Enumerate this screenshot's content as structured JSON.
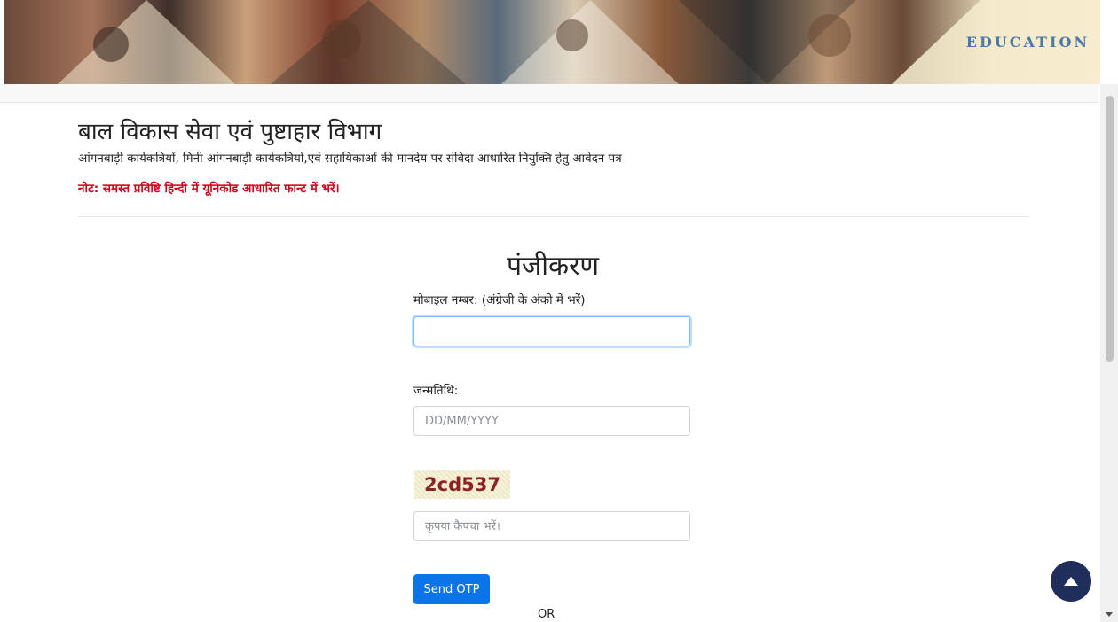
{
  "banner": {
    "word": "EDUCATION"
  },
  "header": {
    "title": "बाल विकास सेवा एवं पुष्टाहार विभाग",
    "subtitle": "आंगनबाड़ी कार्यकत्रियों, मिनी आंगनबाड़ी कार्यकत्रियों,एवं सहायिकाओं की मानदेय पर संविदा आधारित नियुक्ति हेतु आवेदन पत्र",
    "note": "नोट: समस्त प्रविष्टि हिन्दी में यूनिकोड आधारित फान्ट में भरें।"
  },
  "form": {
    "title": "पंजीकरण",
    "mobile_label": "मोबाइल नम्बर: (अंग्रेजी के अंको में भरें)",
    "mobile_value": "",
    "dob_label": "जन्मतिथि:",
    "dob_placeholder": "DD/MM/YYYY",
    "captcha_text": "2cd537",
    "captcha_placeholder": "कृपया कैपचा भरें।",
    "send_otp_label": "Send OTP",
    "or_text": "OR"
  },
  "colors": {
    "accent": "#0a74e8",
    "note": "#d0021b",
    "captcha_text": "#8b2323",
    "scroll_top_button": "#1f2e5a"
  },
  "icons": {
    "scroll_top": "arrow-up-icon"
  }
}
